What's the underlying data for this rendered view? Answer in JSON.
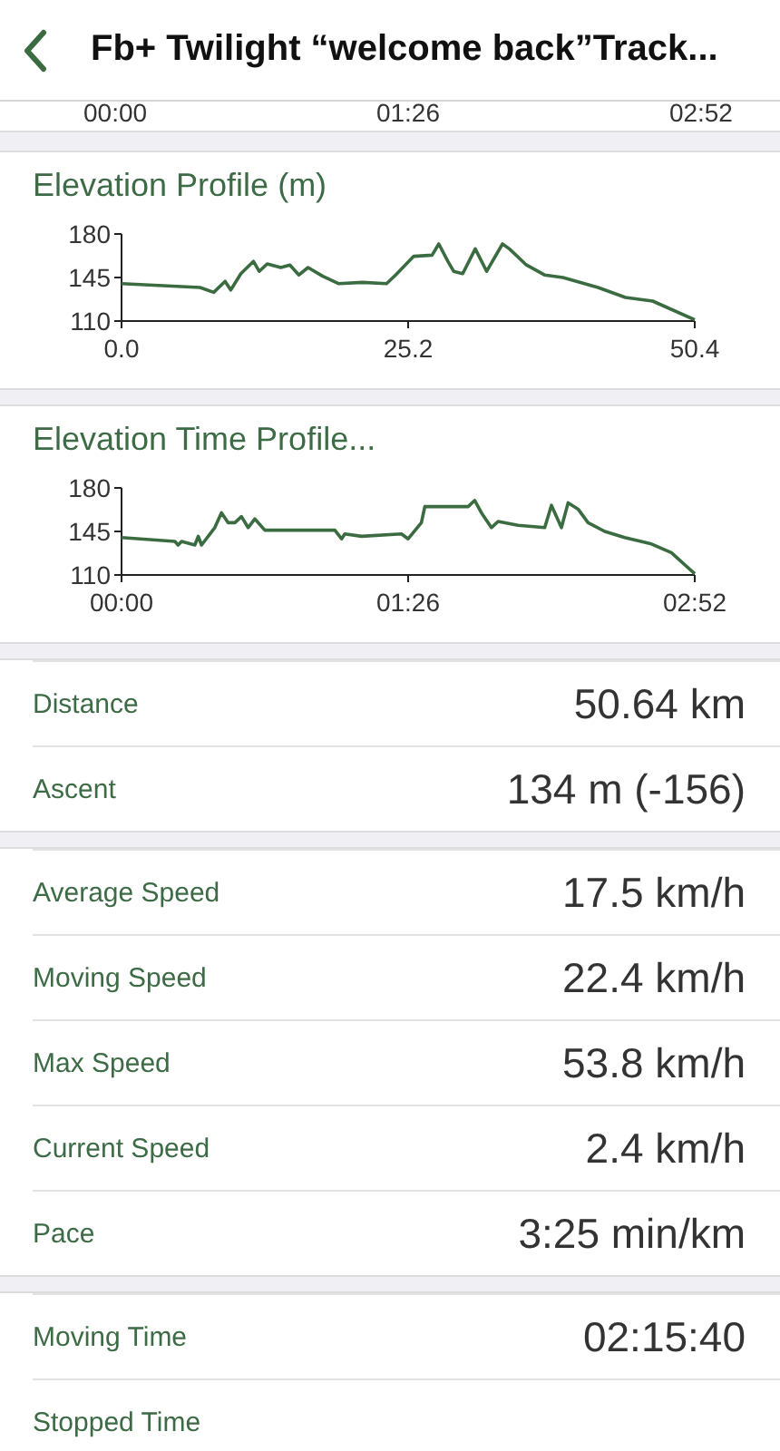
{
  "header": {
    "title": "Fb+ Twilight “welcome back”Track..."
  },
  "previous_chart_axis": [
    "00:00",
    "01:26",
    "02:52"
  ],
  "charts": [
    {
      "title": "Elevation Profile (m)",
      "chart_data": {
        "type": "line",
        "x": [
          0,
          6.9,
          8.1,
          9.1,
          9.6,
          10.5,
          11.6,
          12.1,
          12.8,
          14,
          14.8,
          15.6,
          16.4,
          17.7,
          19.1,
          21.2,
          23.3,
          24.1,
          25.7,
          27.3,
          27.9,
          28.7,
          29.2,
          30,
          31.1,
          32.1,
          33.5,
          34.1,
          35.6,
          37.2,
          38.8,
          41.9,
          44.3,
          46.7,
          50.4
        ],
        "series": [
          {
            "color": "#3b6b40",
            "values": [
              140,
              137,
              133,
              142,
              135,
              148,
              158,
              150,
              156,
              153,
              155,
              147,
              153,
              146,
              140,
              141,
              140,
              147,
              162,
              163,
              172,
              158,
              150,
              148,
              168,
              150,
              172,
              168,
              155,
              147,
              145,
              137,
              129,
              126,
              111
            ]
          }
        ],
        "xlim": [
          0,
          50.4
        ],
        "ylim": [
          110,
          180
        ],
        "xticks": [
          {
            "value": 0,
            "label": "0.0"
          },
          {
            "value": 25.2,
            "label": "25.2"
          },
          {
            "value": 50.4,
            "label": "50.4"
          }
        ],
        "yticks": [
          110,
          145,
          180
        ]
      }
    },
    {
      "title": "Elevation Time Profile...",
      "chart_data": {
        "type": "line",
        "x": [
          0,
          16,
          17,
          18,
          22,
          23,
          24,
          28,
          30,
          32,
          34,
          36,
          38,
          40,
          43,
          64,
          66,
          67,
          72,
          84,
          86,
          90,
          91,
          104,
          106,
          108,
          111,
          113,
          119,
          127,
          129,
          132,
          134,
          137,
          140,
          145,
          151,
          159,
          165,
          172
        ],
        "series": [
          {
            "color": "#3b6b40",
            "values": [
              140,
              137,
              134,
              137,
              134,
              141,
              134,
              148,
              160,
              152,
              152,
              157,
              148,
              155,
              146,
              146,
              139,
              143,
              141,
              143,
              139,
              152,
              165,
              165,
              170,
              160,
              148,
              153,
              150,
              148,
              166,
              148,
              168,
              163,
              152,
              145,
              140,
              135,
              128,
              111
            ]
          }
        ],
        "xlim": [
          0,
          172
        ],
        "ylim": [
          110,
          180
        ],
        "xticks": [
          {
            "value": 0,
            "label": "00:00"
          },
          {
            "value": 86,
            "label": "01:26"
          },
          {
            "value": 172,
            "label": "02:52"
          }
        ],
        "yticks": [
          110,
          145,
          180
        ]
      }
    }
  ],
  "stat_groups": [
    {
      "rows": [
        {
          "label": "Distance",
          "value": "50.64 km"
        },
        {
          "label": "Ascent",
          "value": "134 m (-156)"
        }
      ]
    },
    {
      "rows": [
        {
          "label": "Average Speed",
          "value": "17.5 km/h"
        },
        {
          "label": "Moving Speed",
          "value": "22.4 km/h"
        },
        {
          "label": "Max Speed",
          "value": "53.8 km/h"
        },
        {
          "label": "Current Speed",
          "value": "2.4 km/h"
        },
        {
          "label": "Pace",
          "value": "3:25 min/km"
        }
      ]
    },
    {
      "rows": [
        {
          "label": "Moving Time",
          "value": "02:15:40"
        },
        {
          "label": "Stopped Time"
        }
      ]
    }
  ]
}
